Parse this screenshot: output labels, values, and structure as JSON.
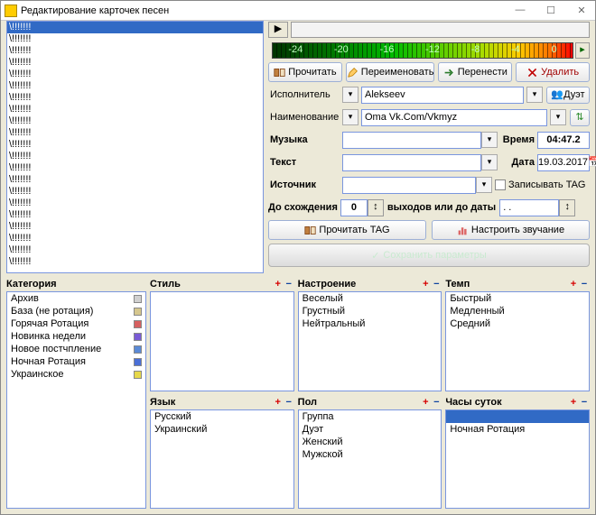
{
  "title": "Редактирование карточек песен",
  "spectrum_ticks": [
    "-24",
    "-20",
    "-16",
    "-12",
    "-8",
    "-4",
    "0"
  ],
  "toolbar": {
    "read": "Прочитать",
    "rename": "Переименовать",
    "move": "Перенести",
    "delete": "Удалить"
  },
  "form": {
    "performer_label": "Исполнитель",
    "performer_value": "Alekseev",
    "duet_label": "Дуэт",
    "title_label": "Наименование",
    "title_value": "Oma Vk.Com/Vkmyz",
    "music_label": "Музыка",
    "music_value": "",
    "time_label": "Время",
    "time_value": "04:47.2",
    "text_label": "Текст",
    "text_value": "",
    "date_label": "Дата",
    "date_value": "19.03.2017",
    "source_label": "Источник",
    "source_value": "",
    "tag_label": "Записывать TAG",
    "converge_label": "До схождения",
    "converge_value": "0",
    "exits_label": "выходов или до даты",
    "exits_value": ". .",
    "read_tag": "Прочитать TAG",
    "tune_sound": "Настроить звучание",
    "save": "Сохранить параметры"
  },
  "list_sel": "\\!!!!!!!",
  "list_item": "\\!!!!!!!",
  "panels": {
    "category": {
      "title": "Категория",
      "items": [
        {
          "t": "Архив",
          "c": "#d0d0d0"
        },
        {
          "t": "База (не ротация)",
          "c": "#d6c78e"
        },
        {
          "t": "Горячая Ротация",
          "c": "#d66060"
        },
        {
          "t": "Новинка недели",
          "c": "#7a5bd6"
        },
        {
          "t": "Новое постчпление",
          "c": "#5b8ad6"
        },
        {
          "t": "Ночная Ротация",
          "c": "#4a6fd6"
        },
        {
          "t": "Украинское",
          "c": "#e6d84a"
        }
      ]
    },
    "style": {
      "title": "Стиль",
      "items": []
    },
    "mood": {
      "title": "Настроение",
      "items": [
        "Веселый",
        "Грустный",
        "Нейтральный"
      ]
    },
    "tempo": {
      "title": "Темп",
      "items": [
        "Быстрый",
        "Медленный",
        "Средний"
      ]
    },
    "lang": {
      "title": "Язык",
      "items": [
        "Русский",
        "Украинский"
      ]
    },
    "sex": {
      "title": "Пол",
      "items": [
        "Группа",
        "Дуэт",
        "Женский",
        "Мужской"
      ]
    },
    "hours": {
      "title": "Часы суток",
      "sel": "",
      "items": [
        "Ночная Ротация"
      ]
    }
  }
}
